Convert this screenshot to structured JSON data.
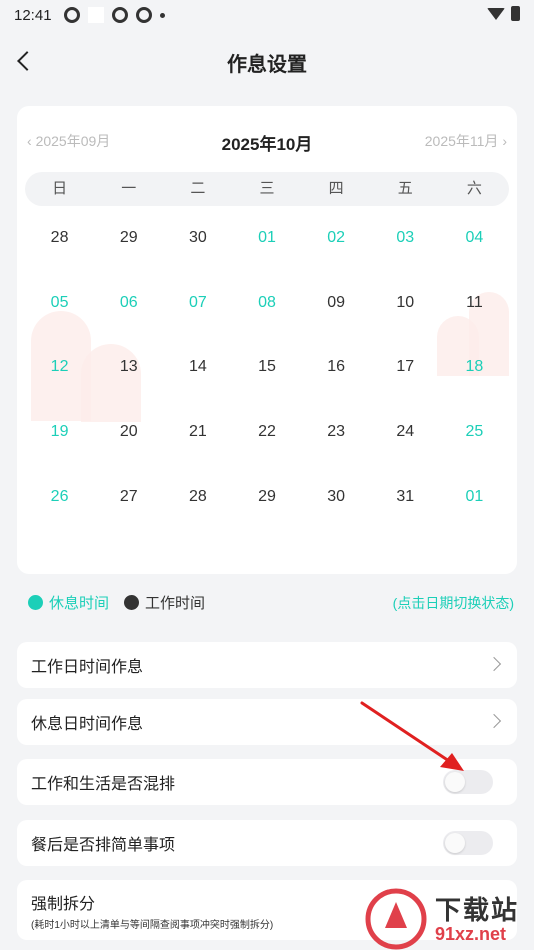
{
  "status_bar": {
    "time": "12:41"
  },
  "header": {
    "title": "作息设置"
  },
  "calendar": {
    "prev_month": "2025年09月",
    "current_month": "2025年10月",
    "next_month": "2025年11月",
    "weekdays": [
      "日",
      "一",
      "二",
      "三",
      "四",
      "五",
      "六"
    ],
    "weeks": [
      [
        {
          "d": "28",
          "rest": false
        },
        {
          "d": "29",
          "rest": false
        },
        {
          "d": "30",
          "rest": false
        },
        {
          "d": "01",
          "rest": true
        },
        {
          "d": "02",
          "rest": true
        },
        {
          "d": "03",
          "rest": true
        },
        {
          "d": "04",
          "rest": true
        }
      ],
      [
        {
          "d": "05",
          "rest": true
        },
        {
          "d": "06",
          "rest": true
        },
        {
          "d": "07",
          "rest": true
        },
        {
          "d": "08",
          "rest": true
        },
        {
          "d": "09",
          "rest": false
        },
        {
          "d": "10",
          "rest": false
        },
        {
          "d": "11",
          "rest": false
        }
      ],
      [
        {
          "d": "12",
          "rest": true
        },
        {
          "d": "13",
          "rest": false
        },
        {
          "d": "14",
          "rest": false
        },
        {
          "d": "15",
          "rest": false
        },
        {
          "d": "16",
          "rest": false
        },
        {
          "d": "17",
          "rest": false
        },
        {
          "d": "18",
          "rest": true
        }
      ],
      [
        {
          "d": "19",
          "rest": true
        },
        {
          "d": "20",
          "rest": false
        },
        {
          "d": "21",
          "rest": false
        },
        {
          "d": "22",
          "rest": false
        },
        {
          "d": "23",
          "rest": false
        },
        {
          "d": "24",
          "rest": false
        },
        {
          "d": "25",
          "rest": true
        }
      ],
      [
        {
          "d": "26",
          "rest": true
        },
        {
          "d": "27",
          "rest": false
        },
        {
          "d": "28",
          "rest": false
        },
        {
          "d": "29",
          "rest": false
        },
        {
          "d": "30",
          "rest": false
        },
        {
          "d": "31",
          "rest": false
        },
        {
          "d": "01",
          "rest": true
        }
      ]
    ]
  },
  "legend": {
    "rest_label": "休息时间",
    "work_label": "工作时间",
    "hint": "(点击日期切换状态)"
  },
  "settings": {
    "workday_schedule": "工作日时间作息",
    "restday_schedule": "休息日时间作息",
    "mix_work_life": "工作和生活是否混排",
    "mix_work_life_on": false,
    "after_meal_simple": "餐后是否排简单事项",
    "after_meal_simple_on": false,
    "force_split": "强制拆分",
    "force_split_desc": "(耗时1小时以上清单与等间隔查阅事项冲突时强制拆分)"
  },
  "watermark": {
    "text": "下载站",
    "site": "91xz.net"
  },
  "colors": {
    "rest": "#1ccfb8",
    "work": "#333333",
    "annotation_arrow": "#e02020"
  }
}
